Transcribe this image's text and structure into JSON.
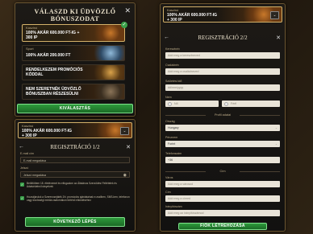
{
  "panel1": {
    "title_line1": "VÁLASZD KI ÜDVÖZLŐ",
    "title_line2": "BÓNUSZODAT",
    "offers": [
      {
        "category": "Kaszinó",
        "line1": "100% AKÁR 600.000 FT-IG +",
        "line2": "300 IP",
        "selected": true
      },
      {
        "category": "Sport",
        "line1": "100% AKÁR 200.000 FT",
        "line2": "",
        "selected": false
      },
      {
        "category": "",
        "line1": "RENDELKEZEM PROMÓCIÓS",
        "line2": "KÓDDAL",
        "selected": false
      },
      {
        "category": "",
        "line1": "NEM SZERETNÉK ÜDVÖZLŐ",
        "line2": "BÓNUSZBAN RÉSZESÜLNI",
        "selected": false
      }
    ],
    "select_button": "KIVÁLASZTÁS"
  },
  "panel2": {
    "bonus": {
      "category": "Kaszinó",
      "line1": "100% AKÁR 600.000 FT-IG",
      "line2": "+ 300 IP"
    },
    "heading": "REGISZTRÁCIÓ 1/2",
    "email_label": "E-mail cím",
    "email_placeholder": "E-mail megadása",
    "password_label": "Jelszó",
    "password_placeholder": "Jelszó megadása",
    "consent1": "Betöltöttem 18. életévemet és elfogadom az Általános Szerződési Feltételek és Adatvédelmi Irányelvek",
    "consent2": "Hozzájárulok a Szerencsejáték Zrt. promóciós ajánlatainak e-mailben, SMS-ben, telefonon vagy közösségi média csatornákon történő elküldéséhez",
    "next_button": "KÖVETKEZŐ LÉPÉS"
  },
  "panel3": {
    "bonus": {
      "category": "Kaszinó",
      "line1": "100% AKÁR 600.000 FT-IG",
      "line2": "+ 300 IP"
    },
    "heading": "REGISZTRÁCIÓ 2/2",
    "fields": [
      {
        "label": "Keresztnév",
        "placeholder": "Add meg a keresztneved"
      },
      {
        "label": "Családnév",
        "placeholder": "Add meg a családneved"
      },
      {
        "label": "Születési idő",
        "placeholder": "dd/mm/yyyy"
      }
    ],
    "gender_label": "Nem",
    "gender_female": "Nő",
    "gender_male": "Férfi",
    "profile_section": "Profil adatai",
    "country_label": "Ország",
    "country_value": "Hungary",
    "currency_label": "Pénznem",
    "currency_value": "Forint",
    "phone_label": "Telefonszám",
    "phone_value": "+36",
    "address_section": "Cím",
    "city_label": "Város",
    "city_placeholder": "Add meg a városod",
    "street_label": "Cím",
    "street_placeholder": "Add meg a címed",
    "zip_label": "Irányítószám",
    "zip_placeholder": "Add meg az irányítószámod",
    "create_button": "FIÓK LÉTREHOZÁSA"
  }
}
